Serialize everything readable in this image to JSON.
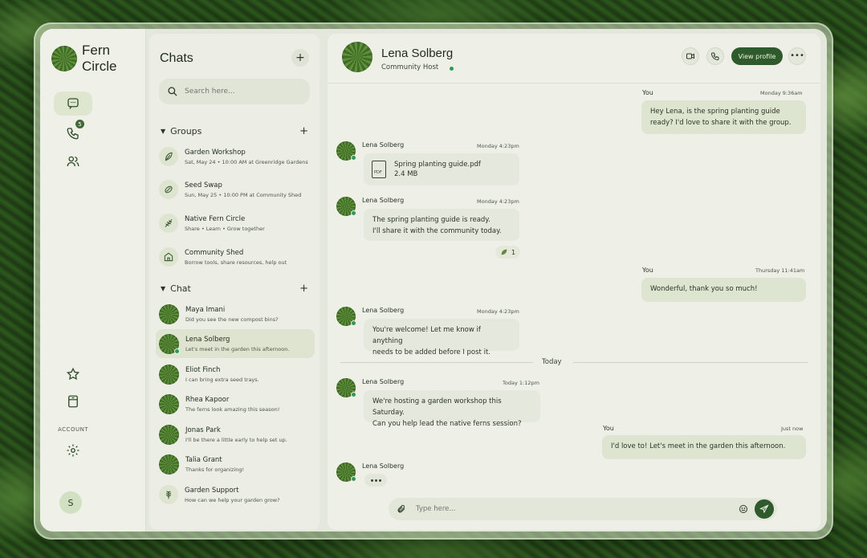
{
  "app": {
    "name": "Fern Circle"
  },
  "rail": {
    "account_label": "ACCOUNT",
    "calls_badge": "5",
    "user_initial": "S"
  },
  "chats": {
    "title": "Chats",
    "search_placeholder": "Search here...",
    "groups_label": "Groups",
    "groups": [
      {
        "name": "Garden Workshop",
        "sub": "Sat, May 24 • 10:00 AM at Greenridge Gardens",
        "icon": "fern-leaf-icon"
      },
      {
        "name": "Seed Swap",
        "sub": "Sun, May 25 • 10:00 PM at Community Shed",
        "icon": "seed-icon"
      },
      {
        "name": "Native Fern Circle",
        "sub": "Share • Learn • Grow together",
        "icon": "sprout-icon"
      },
      {
        "name": "Community Shed",
        "sub": "Borrow tools, share resources, help out",
        "icon": "shed-icon"
      }
    ],
    "chat_label": "Chat",
    "chats": [
      {
        "name": "Maya Imani",
        "sub": "Did you see the new compost bins?",
        "online": false
      },
      {
        "name": "Lena Solberg",
        "sub": "Let's meet in the garden this afternoon.",
        "online": true,
        "active": true
      },
      {
        "name": "Eliot Finch",
        "sub": "I can bring extra seed trays.",
        "online": false
      },
      {
        "name": "Rhea Kapoor",
        "sub": "The ferns look amazing this season!",
        "online": false
      },
      {
        "name": "Jonas Park",
        "sub": "I'll be there a little early to help set up.",
        "online": false
      },
      {
        "name": "Talia Grant",
        "sub": "Thanks for organizing!",
        "online": false
      },
      {
        "name": "Garden Support",
        "sub": "How can we help your garden grow?",
        "online": false
      }
    ]
  },
  "conversation": {
    "contact_name": "Lena Solberg",
    "contact_role": "Community Host",
    "view_profile_label": "View profile",
    "day_separator": "Today",
    "composer_placeholder": "Type here...",
    "messages": [
      {
        "from": "You",
        "time": "Monday 9:36am",
        "lines": [
          "Hey Lena, is the spring planting guide",
          "ready? I'd love to share it with the group."
        ]
      },
      {
        "from": "Lena Solberg",
        "time": "Monday 4:23pm",
        "file_name": "Spring planting guide.pdf",
        "file_size": "2.4 MB"
      },
      {
        "from": "Lena Solberg",
        "time": "Monday 4:23pm",
        "lines": [
          "The spring planting guide is ready.",
          "I'll share it with the community today."
        ],
        "reaction_count": "1"
      },
      {
        "from": "You",
        "time": "Thursday 11:41am",
        "lines": [
          "Wonderful, thank you so much!"
        ]
      },
      {
        "from": "Lena Solberg",
        "time": "Monday 4:23pm",
        "lines": [
          "You're welcome! Let me know if anything",
          "needs to be added before I post it."
        ]
      },
      {
        "from": "Lena Solberg",
        "time": "Today 1:12pm",
        "lines": [
          "We're hosting a garden workshop this Saturday.",
          "Can you help lead the native ferns session?"
        ]
      },
      {
        "from": "You",
        "time": "Just now",
        "lines": [
          "I'd love to! Let's meet in the garden this afternoon."
        ]
      },
      {
        "from": "Lena Solberg",
        "typing": true
      }
    ]
  }
}
